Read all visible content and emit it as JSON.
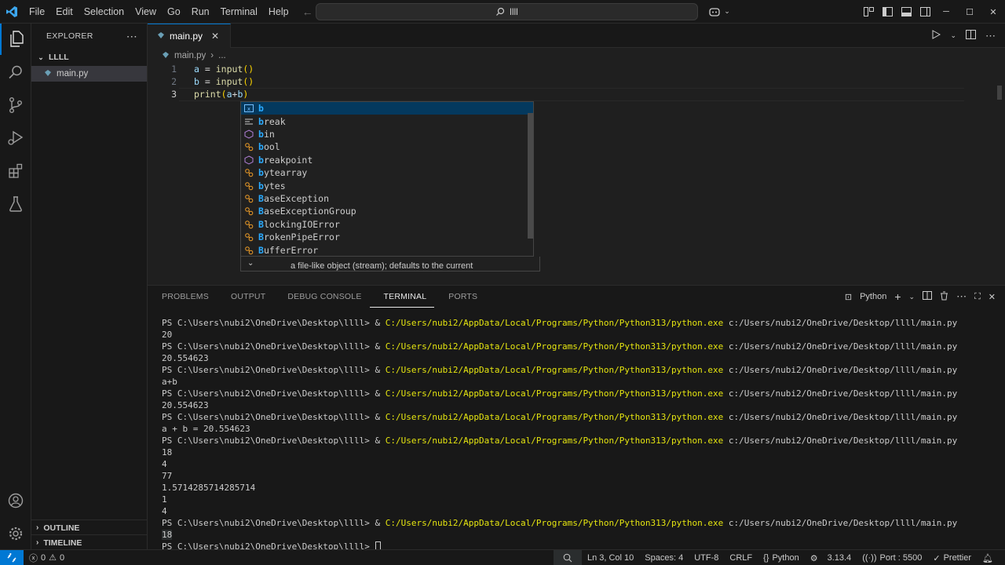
{
  "titlebar": {
    "menu": [
      "File",
      "Edit",
      "Selection",
      "View",
      "Go",
      "Run",
      "Terminal",
      "Help"
    ],
    "command_center": "llll"
  },
  "sidebar": {
    "title": "EXPLORER",
    "folder": "LLLL",
    "file": "main.py",
    "outline": "OUTLINE",
    "timeline": "TIMELINE"
  },
  "editor": {
    "tab_label": "main.py",
    "breadcrumb_file": "main.py",
    "breadcrumb_more": "...",
    "line_numbers": [
      "1",
      "2",
      "3"
    ]
  },
  "suggest": {
    "items": [
      {
        "label": "b",
        "icon": "variable-icon"
      },
      {
        "label": "break",
        "icon": "keyword-icon"
      },
      {
        "label": "bin",
        "icon": "function-icon"
      },
      {
        "label": "bool",
        "icon": "class-icon"
      },
      {
        "label": "breakpoint",
        "icon": "function-icon"
      },
      {
        "label": "bytearray",
        "icon": "class-icon"
      },
      {
        "label": "bytes",
        "icon": "class-icon"
      },
      {
        "label": "BaseException",
        "icon": "class-icon"
      },
      {
        "label": "BaseExceptionGroup",
        "icon": "class-icon"
      },
      {
        "label": "BlockingIOError",
        "icon": "class-icon"
      },
      {
        "label": "BrokenPipeError",
        "icon": "class-icon"
      },
      {
        "label": "BufferError",
        "icon": "class-icon"
      }
    ],
    "detail": "a file-like object (stream); defaults to the current"
  },
  "panel": {
    "tabs": [
      "PROBLEMS",
      "OUTPUT",
      "DEBUG CONSOLE",
      "TERMINAL",
      "PORTS"
    ],
    "active_tab": "TERMINAL",
    "shell": "Python"
  },
  "terminal": {
    "prompt": "PS C:\\Users\\nubi2\\OneDrive\\Desktop\\llll> ",
    "exe": "C:/Users/nubi2/AppData/Local/Programs/Python/Python313/python.exe",
    "script": " c:/Users/nubi2/OneDrive/Desktop/llll/main.py",
    "lines": [
      {
        "type": "cmd"
      },
      {
        "type": "out",
        "text": "20"
      },
      {
        "type": "cmd"
      },
      {
        "type": "out",
        "text": "20.554623"
      },
      {
        "type": "cmd"
      },
      {
        "type": "out",
        "text": "a+b"
      },
      {
        "type": "cmd"
      },
      {
        "type": "out",
        "text": "20.554623"
      },
      {
        "type": "cmd"
      },
      {
        "type": "out",
        "text": "a + b = 20.554623"
      },
      {
        "type": "cmd"
      },
      {
        "type": "out",
        "text": "18"
      },
      {
        "type": "out",
        "text": "4"
      },
      {
        "type": "out",
        "text": "77"
      },
      {
        "type": "out",
        "text": "1.5714285714285714"
      },
      {
        "type": "out",
        "text": "1"
      },
      {
        "type": "out",
        "text": "4"
      },
      {
        "type": "cmd"
      },
      {
        "type": "out",
        "text": "18",
        "highlight": true
      },
      {
        "type": "prompt"
      }
    ]
  },
  "statusbar": {
    "errors": "0",
    "warnings": "0",
    "position": "Ln 3, Col 10",
    "spaces": "Spaces: 4",
    "encoding": "UTF-8",
    "eol": "CRLF",
    "language": "Python",
    "python_version": "3.13.4",
    "port": "Port : 5500",
    "prettier": "Prettier"
  },
  "colors": {
    "accent": "#0078d4",
    "exe_path": "#e5e510",
    "match_highlight": "#2aaaff"
  }
}
